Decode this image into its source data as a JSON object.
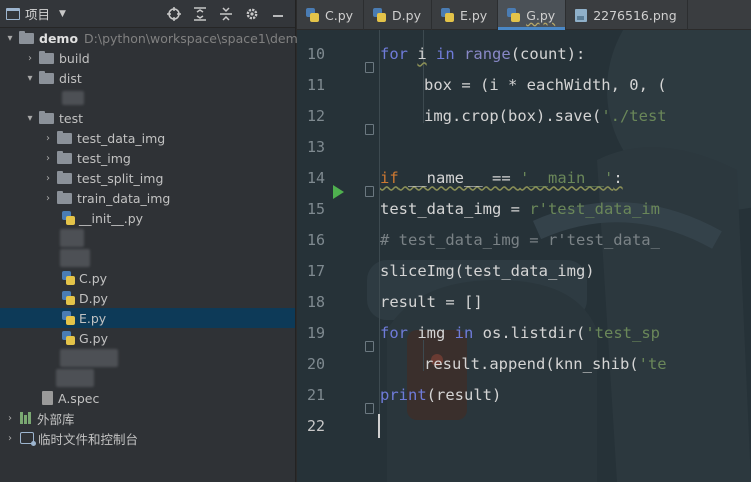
{
  "project_panel": {
    "title": "项目",
    "tree": [
      {
        "type": "folder",
        "label": "demo",
        "path": "D:\\python\\workspace\\space1\\demo",
        "expanded": true,
        "bold": true
      },
      {
        "type": "folder",
        "label": "build",
        "expanded": false
      },
      {
        "type": "folder",
        "label": "dist",
        "expanded": true
      },
      {
        "type": "folder",
        "label": "test",
        "expanded": true
      },
      {
        "type": "folder",
        "label": "test_data_img",
        "expanded": false
      },
      {
        "type": "folder",
        "label": "test_img",
        "expanded": false
      },
      {
        "type": "folder",
        "label": "test_split_img",
        "expanded": false
      },
      {
        "type": "folder",
        "label": "train_data_img",
        "expanded": false
      },
      {
        "type": "pyfile",
        "label": "__init__.py"
      },
      {
        "type": "pyfile",
        "label": "C.py"
      },
      {
        "type": "pyfile",
        "label": "D.py"
      },
      {
        "type": "pyfile",
        "label": "E.py",
        "selected": true
      },
      {
        "type": "pyfile",
        "label": "G.py"
      },
      {
        "type": "specfile",
        "label": "A.spec"
      },
      {
        "type": "library",
        "label": "外部库"
      },
      {
        "type": "scratches",
        "label": "临时文件和控制台"
      }
    ]
  },
  "tabs": [
    {
      "label": "C.py",
      "icon": "python-file-icon"
    },
    {
      "label": "D.py",
      "icon": "python-file-icon"
    },
    {
      "label": "E.py",
      "icon": "python-file-icon"
    },
    {
      "label": "G.py",
      "icon": "python-file-icon",
      "active": true
    },
    {
      "label": "2276516.png",
      "icon": "image-file-icon"
    }
  ],
  "code": {
    "line_numbers": [
      "10",
      "11",
      "12",
      "13",
      "14",
      "15",
      "16",
      "17",
      "18",
      "19",
      "20",
      "21",
      "22"
    ],
    "lines": {
      "l10_for": "for",
      "l10_i": "i",
      "l10_in": "in",
      "l10_range": "range",
      "l10_rest": "(count):",
      "l11": "box = (i * eachWidth, 0, (",
      "l12_a": "img.crop(box).save(",
      "l12_str": "'./test",
      "l14_if": "if",
      "l14_name": " __name__ == ",
      "l14_str": "'__main__'",
      "l14_colon": ":",
      "l15_a": "test_data_img = ",
      "l15_str": "r'test_data_im",
      "l16_cmt": "# test_data_img = r'test_data_",
      "l17": "sliceImg(test_data_img)",
      "l18": "result = []",
      "l19_for": "for",
      "l19_a": " img ",
      "l19_in": "in",
      "l19_b": " os.listdir(",
      "l19_str": "'test_sp",
      "l20_a": "result.append(knn_shib(",
      "l20_str": "'te",
      "l21_print": "print",
      "l21_rest": "(result)"
    }
  },
  "colors": {
    "accent": "#4a88c7",
    "selection": "#0d3a58",
    "keyword": "#cc7832",
    "string": "#6a8759",
    "run_arrow": "#4fb04f"
  }
}
